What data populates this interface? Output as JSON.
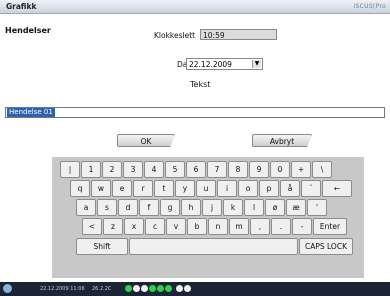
{
  "window": {
    "title": "Grafikk",
    "brand": "iSCUS(Pro"
  },
  "dialog": {
    "heading": "Hendelser",
    "clock_label": "Klokkeslett",
    "clock_value": "10:59",
    "date_label": "Dato",
    "date_value": "22.12.2009",
    "text_label": "Tekst",
    "text_value": "Hendelse 01",
    "ok_label": "OK",
    "cancel_label": "Avbryt"
  },
  "keyboard": {
    "row1": [
      "|",
      "1",
      "2",
      "3",
      "4",
      "5",
      "6",
      "7",
      "8",
      "9",
      "0",
      "+",
      "\\"
    ],
    "backspace": "←",
    "row2": [
      "q",
      "w",
      "e",
      "r",
      "t",
      "y",
      "u",
      "i",
      "o",
      "p",
      "å",
      "¨"
    ],
    "row3": [
      "a",
      "s",
      "d",
      "f",
      "g",
      "h",
      "j",
      "k",
      "l",
      "ø",
      "æ",
      "'"
    ],
    "row4": [
      "<",
      "z",
      "x",
      "c",
      "v",
      "b",
      "n",
      "m",
      ",",
      ".",
      "-"
    ],
    "enter": "Enter",
    "shift": "Shift",
    "caps": "CAPS LOCK"
  },
  "status": {
    "datetime": "22.12.2009 11:06",
    "version": "26.2.2C",
    "colors": {
      "green": "#2fd04a",
      "white": "#f2f2f2",
      "dark": "#1b2536"
    }
  }
}
